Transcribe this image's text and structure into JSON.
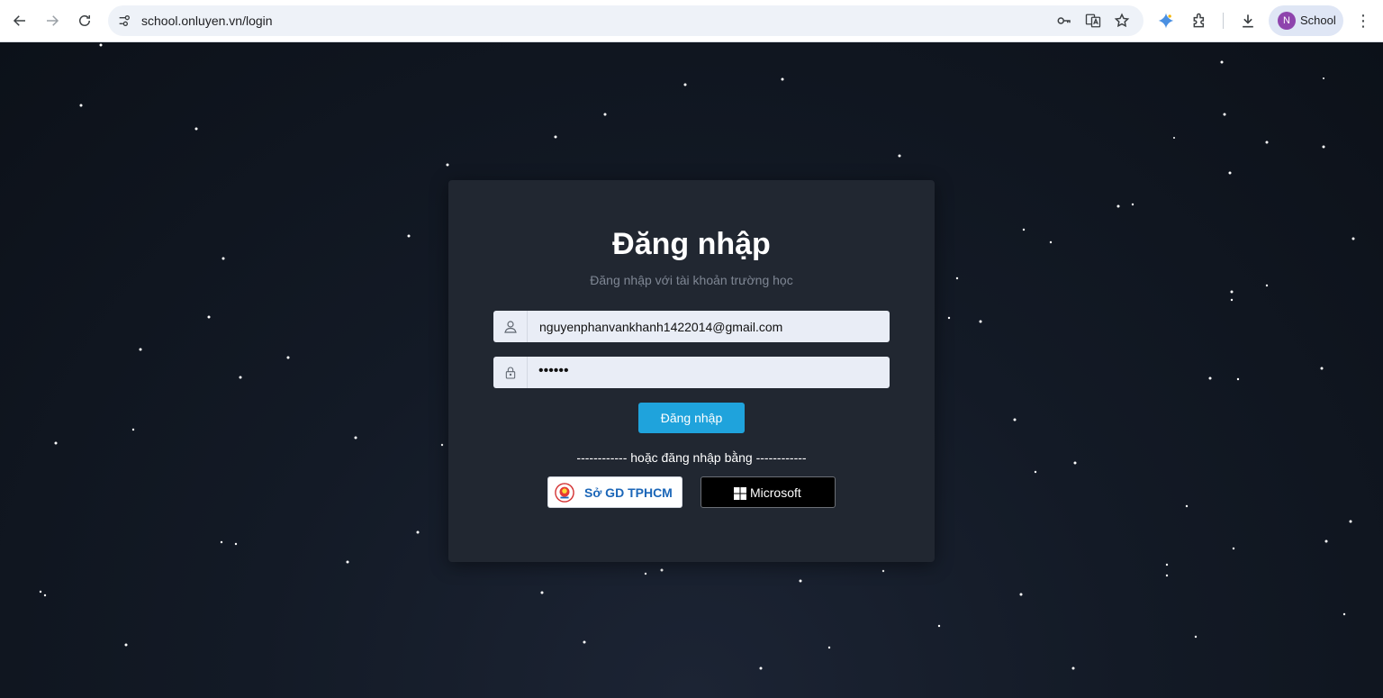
{
  "browser": {
    "url": "school.onluyen.vn/login",
    "profile": {
      "initial": "N",
      "name": "School",
      "avatar_color": "#8e44ad"
    },
    "icons": [
      "back-icon",
      "forward-icon",
      "reload-icon",
      "site-info-icon",
      "password-key-icon",
      "translate-icon",
      "bookmark-star-icon",
      "gemini-icon",
      "extensions-icon",
      "download-icon",
      "menu-icon"
    ]
  },
  "login": {
    "title": "Đăng nhập",
    "subtitle": "Đăng nhập với tài khoản trường học",
    "username_value": "nguyenphanvankhanh1422014@gmail.com",
    "password_mask": "••••••",
    "submit_label": "Đăng nhập",
    "divider_text": "------------ hoặc đăng nhập bằng ------------",
    "sso_gd_label": "Sở GD TPHCM",
    "sso_ms_label": "Microsoft"
  },
  "colors": {
    "primary_button": "#1fa3dc",
    "card_background": "#212731",
    "page_background": "#0f141c",
    "sso_gd_text": "#1b66b8"
  }
}
